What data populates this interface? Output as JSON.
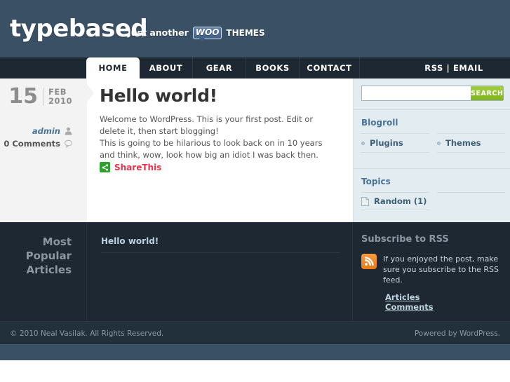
{
  "header": {
    "logo": "typebased",
    "tagline_prefix": "Just another",
    "woo_badge": "WOO",
    "woo_suffix": "THEMES"
  },
  "nav": {
    "items": [
      {
        "label": "HOME",
        "active": true,
        "width": 76
      },
      {
        "label": "ABOUT",
        "active": false,
        "width": 76
      },
      {
        "label": "GEAR",
        "active": false,
        "width": 76
      },
      {
        "label": "BOOKS",
        "active": false,
        "width": 76
      },
      {
        "label": "CONTACT",
        "active": false,
        "width": 86
      }
    ],
    "rss_email": "RSS | EMAIL"
  },
  "post_meta": {
    "day": "15",
    "month": "FEB",
    "year": "2010",
    "author": "admin",
    "comments": "0 Comments"
  },
  "post": {
    "title": "Hello world!",
    "body": "Welcome to WordPress. This is your first post. Edit or delete it, then start blogging!\nThis is going to be hilarious to look back on in 10 years and think, wow, look how big an idiot I was back then.",
    "share_label": "ShareThis"
  },
  "sidebar": {
    "search": {
      "value": "",
      "placeholder": "",
      "button": "SEARCH"
    },
    "blogroll": {
      "title": "Blogroll",
      "links": [
        "Plugins",
        "Themes"
      ]
    },
    "topics": {
      "title": "Topics",
      "items": [
        "Random (1)"
      ]
    }
  },
  "footer": {
    "popular_title": "Most\nPopular\nArticles",
    "articles": [
      "Hello world!"
    ],
    "rss": {
      "title": "Subscribe to RSS",
      "text": "If you enjoyed the post, make sure you subscribe to the RSS feed.",
      "links": [
        "Articles",
        "Comments"
      ]
    }
  },
  "copyright": {
    "left": "© 2010 Neal Vasilak. All Rights Reserved.",
    "right": "Powered by WordPress."
  },
  "colors": {
    "header_bg": "#3a5065",
    "nav_bg": "#1d2832",
    "sidebar_bg": "#e3ecf1",
    "accent_link": "#4a7496",
    "search_green": "#8fc22e",
    "share_red": "#e8334a",
    "rss_orange": "#e87b17"
  }
}
